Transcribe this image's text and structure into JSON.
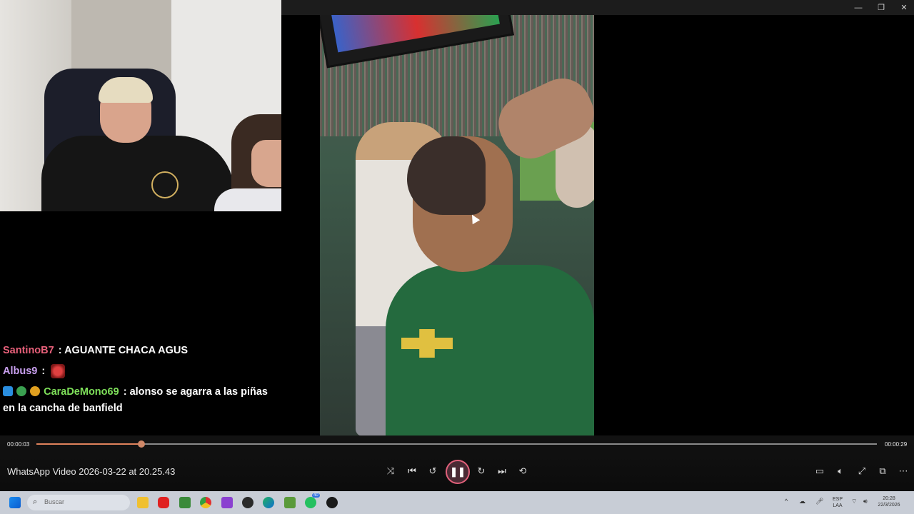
{
  "window": {
    "minimize_icon": "minimize-icon",
    "maximize_icon": "maximize-icon",
    "close_icon": "close-icon"
  },
  "chat": {
    "messages": [
      {
        "user": "SantinoB7",
        "user_color": "#e8607a",
        "separator": ":",
        "text": "AGUANTE CHACA AGUS"
      },
      {
        "user": "Albus9",
        "user_color": "#c9a0f0",
        "separator": ":",
        "emote": "red-devil-emote"
      },
      {
        "user": "CaraDeMono69",
        "user_color": "#7ee05a",
        "separator": ":",
        "badges": [
          "badge-blue",
          "badge-green",
          "badge-gold"
        ],
        "text": "alonso se agarra a las piñas en la cancha de banfield"
      }
    ]
  },
  "player": {
    "current_time": "00:00:03",
    "total_time": "00:00:29",
    "progress_fraction": 0.125,
    "title": "WhatsApp Video 2026-03-22 at 20.25.43",
    "progress_color": "#e0835c",
    "accent_color": "#e0607a",
    "buttons": {
      "shuffle": "shuffle-icon",
      "previous": "previous-icon",
      "rewind": "rewind-10-icon",
      "play_pause": "pause-icon",
      "forward": "forward-30-icon",
      "next": "next-icon",
      "repeat": "repeat-off-icon",
      "miniplayer": "miniplayer-icon",
      "volume": "volume-icon",
      "fullscreen": "fullscreen-icon",
      "cast": "cast-icon",
      "more": "more-options-icon"
    }
  },
  "taskbar": {
    "search_placeholder": "Buscar",
    "apps": [
      "windows-start-icon",
      "file-explorer-icon",
      "youtube-icon",
      "minecraft-icon",
      "chrome-icon",
      "xbox-icon",
      "obs-icon",
      "edge-icon",
      "minecraft-launcher-icon",
      "whatsapp-icon",
      "media-player-icon"
    ],
    "whatsapp_badge": "40",
    "language_line1": "ESP",
    "language_line2": "LAA",
    "time": "20:28",
    "date": "22/3/2026"
  }
}
